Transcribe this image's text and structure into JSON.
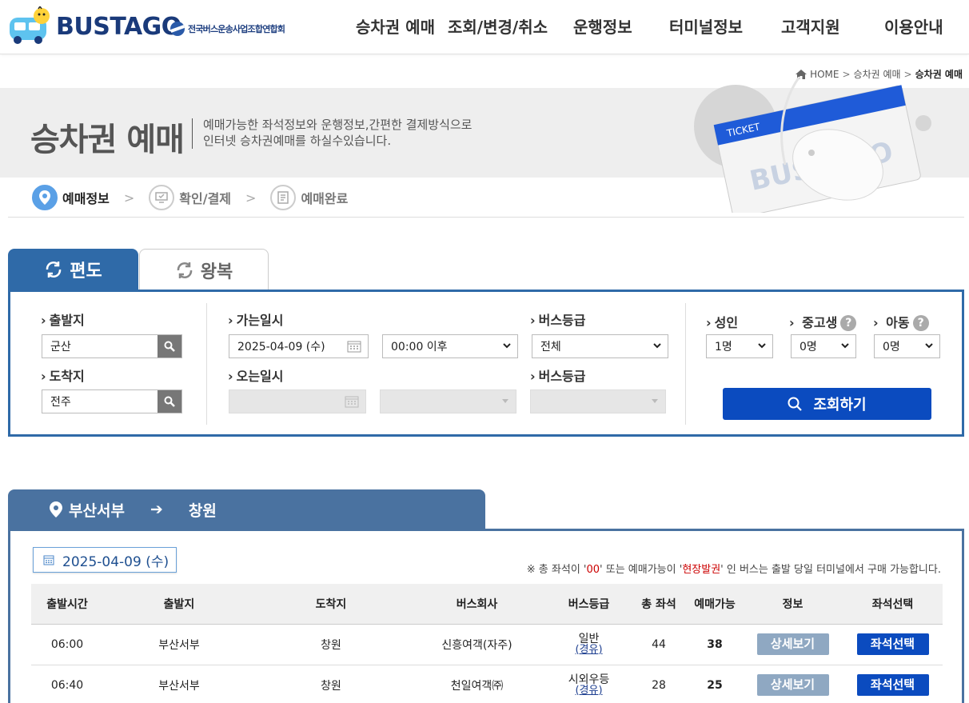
{
  "header": {
    "logo_text": "BUSTAGO",
    "association": "전국버스운송사업조합연합회",
    "nav": [
      "승차권 예매",
      "조회/변경/취소",
      "운행정보",
      "터미널정보",
      "고객지원",
      "이용안내"
    ]
  },
  "breadcrumb": {
    "home": "HOME",
    "items": [
      "승차권 예매",
      "승차권 예매"
    ],
    "sep": ">"
  },
  "banner": {
    "title": "승차권 예매",
    "desc_line1": "예매가능한 좌석정보와 운행정보,간편한 결제방식으로",
    "desc_line2": "인터넷 승차권예매를 하실수있습니다.",
    "ticket_text": "TICKET",
    "ticket_brand": "BUSTAGO"
  },
  "steps": [
    {
      "label": "예매정보",
      "active": true
    },
    {
      "label": "확인/결제",
      "active": false
    },
    {
      "label": "예매완료",
      "active": false
    }
  ],
  "step_arrow": ">",
  "tabs": {
    "oneway": "편도",
    "round": "왕복"
  },
  "search": {
    "departure_label": "출발지",
    "departure_value": "군산",
    "arrival_label": "도착지",
    "arrival_value": "전주",
    "go_date_label": "가는일시",
    "go_date_value": "2025-04-09 (수)",
    "go_time_value": "00:00 이후",
    "return_date_label": "오는일시",
    "bus_grade_label": "버스등급",
    "bus_grade_value": "전체",
    "return_bus_grade_label": "버스등급",
    "adult_label": "성인",
    "adult_value": "1명",
    "teen_label": "중고생",
    "teen_value": "0명",
    "child_label": "아동",
    "child_value": "0명",
    "help_mark": "?",
    "search_button": "조회하기"
  },
  "result": {
    "from": "부산서부",
    "arrow": "➔",
    "to": "창원",
    "date": "2025-04-09 (수)",
    "notice_prefix": "※ 총 좌석이 '",
    "notice_red1": "00",
    "notice_mid": "' 또는 예매가능이 '",
    "notice_red2": "현장발권",
    "notice_suffix": "' 인 버스는 출발 당일 터미널에서 구매 가능합니다.",
    "columns": [
      "출발시간",
      "출발지",
      "도착지",
      "버스회사",
      "버스등급",
      "총 좌석",
      "예매가능",
      "정보",
      "좌석선택"
    ],
    "rows": [
      {
        "time": "06:00",
        "from": "부산서부",
        "to": "창원",
        "company": "신흥여객(자주)",
        "grade": "일반",
        "grade_sub": "(경유)",
        "total": "44",
        "available": "38",
        "detail": "상세보기",
        "select": "좌석선택"
      },
      {
        "time": "06:40",
        "from": "부산서부",
        "to": "창원",
        "company": "천일여객㈜",
        "grade": "시외우등",
        "grade_sub": "(경유)",
        "total": "28",
        "available": "25",
        "detail": "상세보기",
        "select": "좌석선택"
      }
    ]
  },
  "colors": {
    "primary": "#2f6aa8",
    "button": "#0b4bbf",
    "route_tab": "#4a72a0",
    "step_active": "#5aa0e6"
  }
}
